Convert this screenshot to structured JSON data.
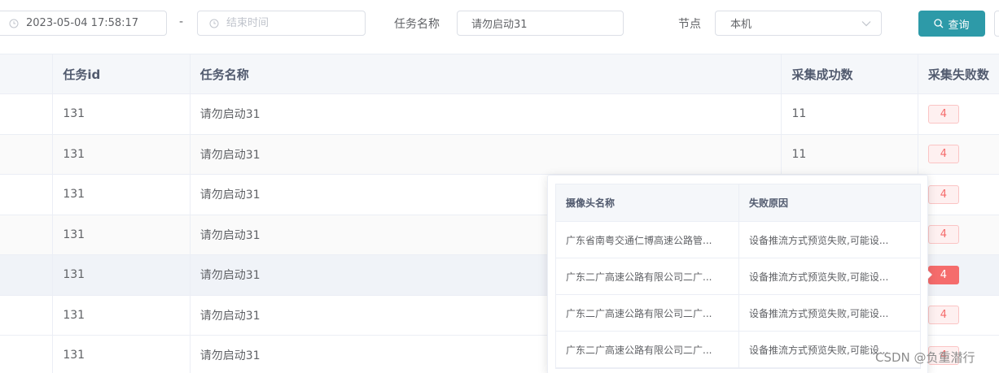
{
  "filters": {
    "start_time_value": "2023-05-04 17:58:17",
    "range_separator": "-",
    "end_time_placeholder": "结束时间",
    "task_name_label": "任务名称",
    "task_name_value": "请勿启动31",
    "node_label": "节点",
    "node_value": "本机",
    "query_label": "查询"
  },
  "table": {
    "headers": [
      "任务id",
      "任务名称",
      "采集成功数",
      "采集失败数"
    ],
    "rows": [
      {
        "id": "131",
        "name": "请勿启动31",
        "success": "11",
        "fail": "4"
      },
      {
        "id": "131",
        "name": "请勿启动31",
        "success": "11",
        "fail": "4"
      },
      {
        "id": "131",
        "name": "请勿启动31",
        "success": "",
        "fail": "4"
      },
      {
        "id": "131",
        "name": "请勿启动31",
        "success": "",
        "fail": "4"
      },
      {
        "id": "131",
        "name": "请勿启动31",
        "success": "",
        "fail": "4"
      },
      {
        "id": "131",
        "name": "请勿启动31",
        "success": "",
        "fail": "4"
      },
      {
        "id": "131",
        "name": "请勿启动31",
        "success": "",
        "fail": "4"
      }
    ]
  },
  "popover": {
    "headers": [
      "摄像头名称",
      "失败原因"
    ],
    "rows": [
      {
        "camera": "广东省南粤交通仁博高速公路管...",
        "reason": "设备推流方式预览失败,可能设..."
      },
      {
        "camera": "广东二广高速公路有限公司二广...",
        "reason": "设备推流方式预览失败,可能设..."
      },
      {
        "camera": "广东二广高速公路有限公司二广...",
        "reason": "设备推流方式预览失败,可能设..."
      },
      {
        "camera": "广东二广高速公路有限公司二广...",
        "reason": "设备推流方式预览失败,可能设..."
      }
    ]
  },
  "watermark": "CSDN @负重潜行",
  "colors": {
    "accent": "#2d9aa8",
    "danger": "#f56c6c",
    "danger_light": "#fef0f0"
  },
  "icons": {
    "date_picker": "clock-icon",
    "select": "chevron-down-icon",
    "query": "search-icon"
  }
}
